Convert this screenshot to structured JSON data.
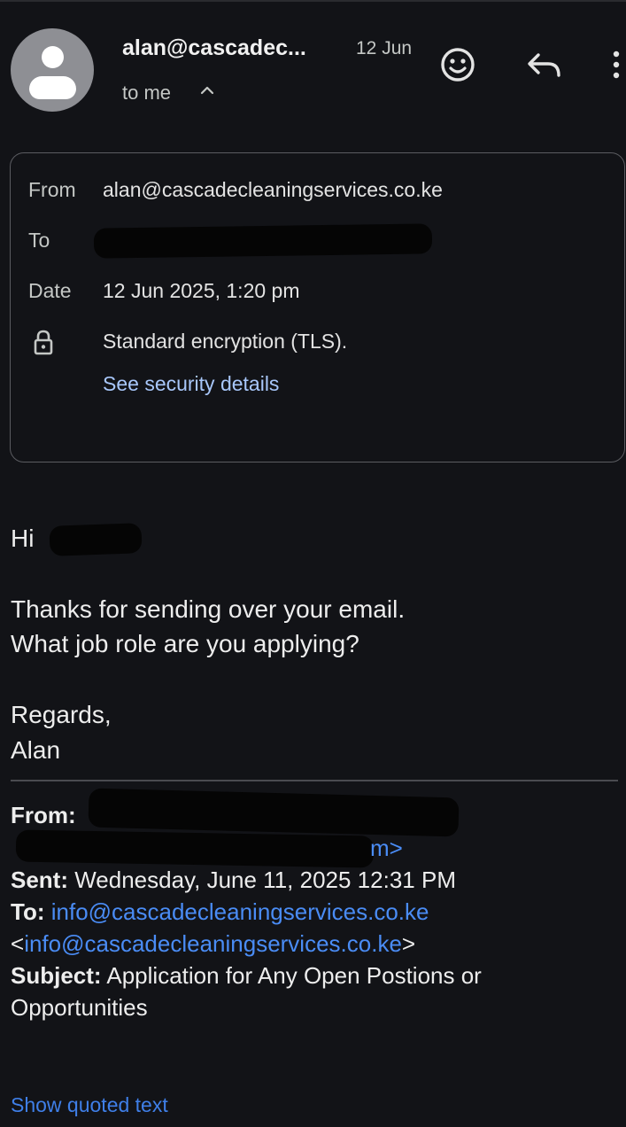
{
  "header": {
    "sender_short": "alan@cascadec...",
    "date_short": "12 Jun",
    "recipient_summary": "to me",
    "icons": {
      "avatar": "person-avatar-icon",
      "expand": "chevron-up-icon",
      "react": "emoji-icon",
      "reply": "reply-icon",
      "more": "more-vert-icon"
    }
  },
  "details": {
    "from_label": "From",
    "from_value": "alan@cascadecleaningservices.co.ke",
    "to_label": "To",
    "date_label": "Date",
    "date_value": "12 Jun 2025, 1:20 pm",
    "encryption": "Standard encryption (TLS).",
    "security_link": "See security details",
    "lock_icon": "lock-icon"
  },
  "message": {
    "greeting": "Hi",
    "line1": "Thanks for sending over your email.",
    "line2": "What job role are you applying?",
    "closing": "Regards,",
    "signature": "Alan"
  },
  "quoted": {
    "from_label": "From:",
    "from_address_end": "m>",
    "sent_label": "Sent:",
    "sent_value": "Wednesday, June 11, 2025 12:31 PM",
    "to_label": "To:",
    "to_email": "info@cascadecleaningservices.co.ke",
    "to_open": "<",
    "to_email_bracketed": "info@cascadecleaningservices.co.ke",
    "to_close": ">",
    "subject_label": "Subject:",
    "subject_line1": "Application for Any Open Postions or",
    "subject_line2": "Opportunities"
  },
  "show_quoted_label": "Show quoted text",
  "colors": {
    "background": "#121317",
    "link": "#a8c7fa",
    "quoted_link": "#4a8cf5",
    "redaction": "#050505"
  }
}
